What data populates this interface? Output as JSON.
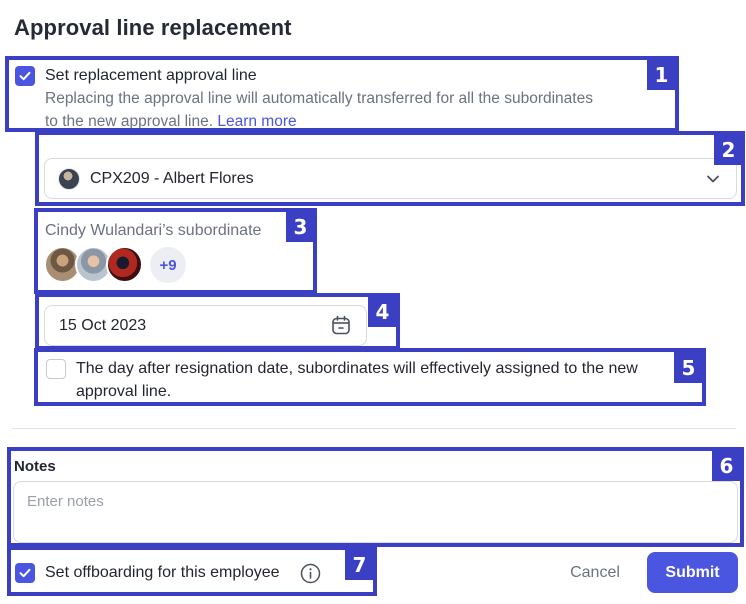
{
  "page": {
    "title": "Approval line replacement"
  },
  "replacement": {
    "checked": true,
    "label": "Set replacement approval line",
    "description_line1": "Replacing the approval line will automatically transferred for all the subordinates",
    "description_line2": "to the new approval line.",
    "learn_more": "Learn more"
  },
  "approver_select": {
    "value": "CPX209 - Albert Flores",
    "icon": "chevron-down-icon"
  },
  "subordinates": {
    "title": "Cindy Wulandari’s subordinate",
    "more_count": "+9"
  },
  "date": {
    "value": "15 Oct 2023",
    "icon": "calendar-icon"
  },
  "effective": {
    "checked": false,
    "line1": "The day after resignation date, subordinates will effectively assigned to the new",
    "line2": "approval line."
  },
  "notes": {
    "label": "Notes",
    "placeholder": "Enter notes"
  },
  "offboarding": {
    "checked": true,
    "label": "Set offboarding for this employee",
    "icon": "info-icon"
  },
  "actions": {
    "cancel_label": "Cancel",
    "submit_label": "Submit"
  },
  "annotations": [
    "1",
    "2",
    "3",
    "4",
    "5",
    "6",
    "7"
  ],
  "colors": {
    "accent": "#4a55e0",
    "annotation": "#3b3fc4",
    "text": "#22262f",
    "muted": "#6b7280"
  }
}
